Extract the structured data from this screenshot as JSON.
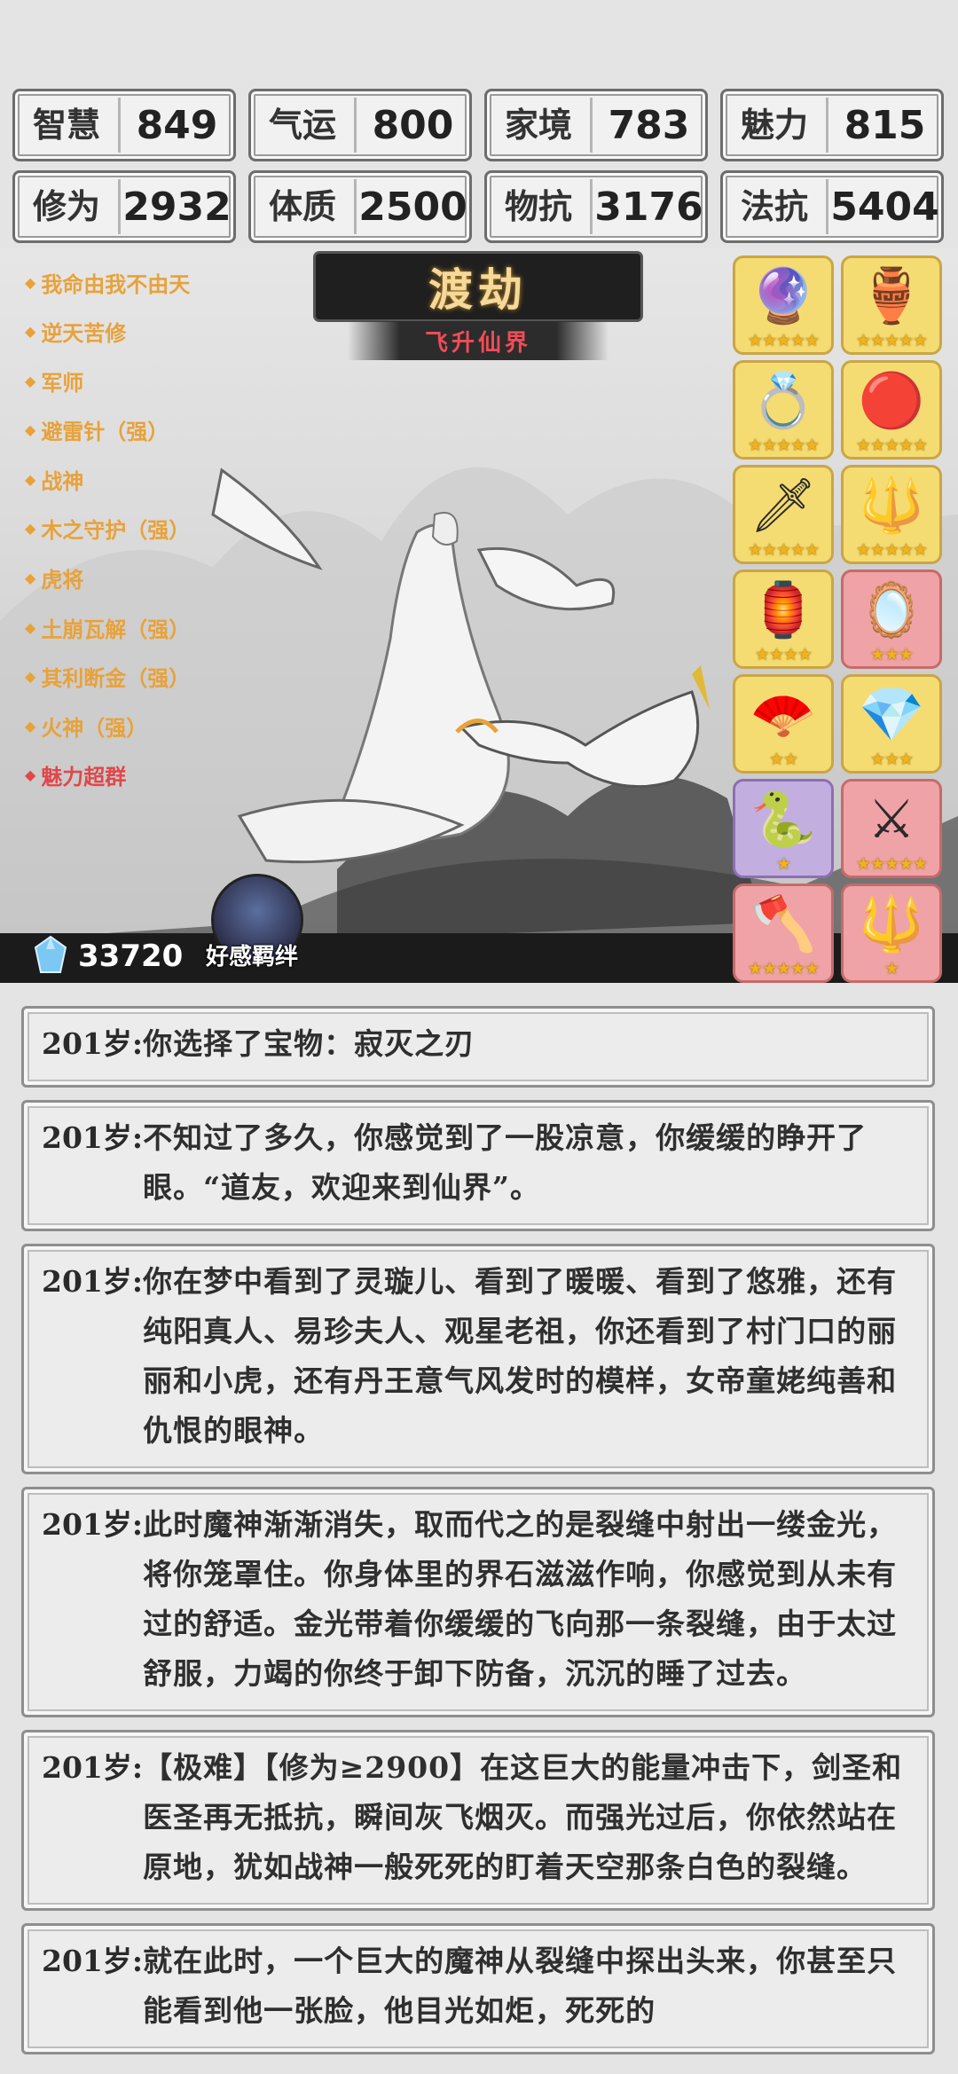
{
  "stats": [
    {
      "label": "智慧",
      "value": "849"
    },
    {
      "label": "气运",
      "value": "800"
    },
    {
      "label": "家境",
      "value": "783"
    },
    {
      "label": "魅力",
      "value": "815"
    },
    {
      "label": "修为",
      "value": "2932"
    },
    {
      "label": "体质",
      "value": "2500"
    },
    {
      "label": "物抗",
      "value": "3176"
    },
    {
      "label": "法抗",
      "value": "5404"
    }
  ],
  "scene": {
    "title": "渡劫",
    "subtitle": "飞升仙界",
    "currency": "33720",
    "bond_label": "好感羁绊"
  },
  "traits": [
    {
      "label": "我命由我不由天",
      "color": "#e8a23a"
    },
    {
      "label": "逆天苦修",
      "color": "#e8a23a"
    },
    {
      "label": "军师",
      "color": "#e8a23a"
    },
    {
      "label": "避雷针（强）",
      "color": "#e8a23a"
    },
    {
      "label": "战神",
      "color": "#e8a23a"
    },
    {
      "label": "木之守护（强）",
      "color": "#e8a23a"
    },
    {
      "label": "虎将",
      "color": "#e8a23a"
    },
    {
      "label": "土崩瓦解（强）",
      "color": "#e8a23a"
    },
    {
      "label": "其利断金（强）",
      "color": "#e8a23a"
    },
    {
      "label": "火神（强）",
      "color": "#e8a23a"
    },
    {
      "label": "魅力超群",
      "color": "#e0474a"
    }
  ],
  "items": [
    {
      "icon": "orb-claw-icon",
      "glyph": "🔮",
      "rarity": "gold",
      "stars": "★★★★★"
    },
    {
      "icon": "pink-vessel-icon",
      "glyph": "🏺",
      "rarity": "gold",
      "stars": "★★★★★"
    },
    {
      "icon": "gold-ring-icon",
      "glyph": "💍",
      "rarity": "gold",
      "stars": "★★★★★"
    },
    {
      "icon": "fire-pearl-icon",
      "glyph": "🔴",
      "rarity": "gold",
      "stars": "★★★★★"
    },
    {
      "icon": "jade-blade-icon",
      "glyph": "🗡",
      "rarity": "gold",
      "stars": "★★★★★"
    },
    {
      "icon": "golden-staff-icon",
      "glyph": "🔱",
      "rarity": "gold",
      "stars": "★★★★★"
    },
    {
      "icon": "incense-burner-icon",
      "glyph": "🏮",
      "rarity": "gold",
      "stars": "★★★★"
    },
    {
      "icon": "dark-mirror-icon",
      "glyph": "🪞",
      "rarity": "red",
      "stars": "★★★"
    },
    {
      "icon": "folding-fan-icon",
      "glyph": "🪭",
      "rarity": "gold",
      "stars": "★★"
    },
    {
      "icon": "rainbow-crystal-icon",
      "glyph": "💎",
      "rarity": "gold",
      "stars": "★★★"
    },
    {
      "icon": "serpent-ring-icon",
      "glyph": "🐍",
      "rarity": "purple",
      "stars": "★"
    },
    {
      "icon": "red-sword-icon",
      "glyph": "⚔",
      "rarity": "red",
      "stars": "★★★★★"
    },
    {
      "icon": "jade-halberd-icon",
      "glyph": "🪓",
      "rarity": "red",
      "stars": "★★★★★"
    },
    {
      "icon": "dragon-spear-icon",
      "glyph": "🔱",
      "rarity": "red",
      "stars": "★"
    }
  ],
  "log": [
    {
      "age": "201岁:",
      "text": "你选择了宝物：寂灭之刃"
    },
    {
      "age": "201岁:",
      "text": "不知过了多久，你感觉到了一股凉意，你缓缓的睁开了眼。“道友，欢迎来到仙界”。"
    },
    {
      "age": "201岁:",
      "text": "你在梦中看到了灵璇儿、看到了暖暖、看到了悠雅，还有纯阳真人、易珍夫人、观星老祖，你还看到了村门口的丽丽和小虎，还有丹王意气风发时的模样，女帝童姥纯善和仇恨的眼神。"
    },
    {
      "age": "201岁:",
      "text": "此时魔神渐渐消失，取而代之的是裂缝中射出一缕金光，将你笼罩住。你身体里的界石滋滋作响，你感觉到从未有过的舒适。金光带着你缓缓的飞向那一条裂缝，由于太过舒服，力竭的你终于卸下防备，沉沉的睡了过去。"
    },
    {
      "age": "201岁:",
      "text": "【极难】【修为≥2900】在这巨大的能量冲击下，剑圣和医圣再无抵抗，瞬间灰飞烟灭。而强光过后，你依然站在原地，犹如战神一般死死的盯着天空那条白色的裂缝。"
    },
    {
      "age": "201岁:",
      "text": "就在此时，一个巨大的魔神从裂缝中探出头来，你甚至只能看到他一张脸，他目光如炬，死死的"
    }
  ]
}
